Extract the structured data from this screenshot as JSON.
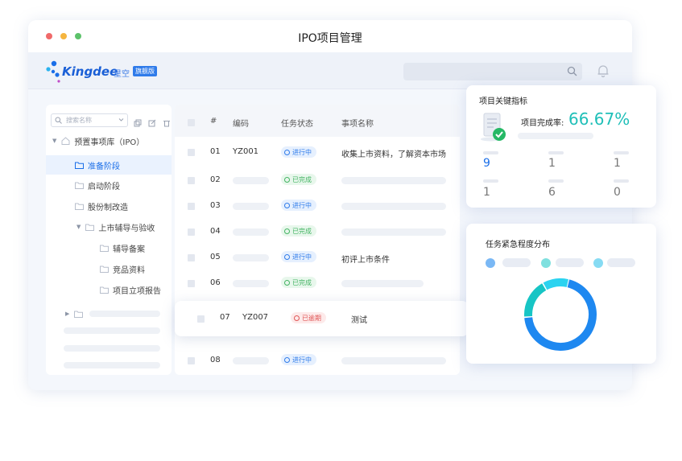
{
  "window": {
    "title": "IPO项目管理"
  },
  "brand": {
    "name": "Kingdee",
    "product": "星空",
    "edition": "旗舰版"
  },
  "sidebar": {
    "search_placeholder": "搜索名称",
    "tree": [
      {
        "label": "预置事项库（IPO）"
      },
      {
        "label": "准备阶段"
      },
      {
        "label": "启动阶段"
      },
      {
        "label": "股份制改造"
      },
      {
        "label": "上市辅导与验收"
      },
      {
        "label": "辅导备案"
      },
      {
        "label": "竞品资料"
      },
      {
        "label": "项目立项报告"
      }
    ]
  },
  "table": {
    "headers": {
      "index": "#",
      "code": "编码",
      "status": "任务状态",
      "name": "事项名称"
    },
    "rows": [
      {
        "index": "01",
        "code": "YZ001",
        "status": "进行中",
        "name": "收集上市资料，了解资本市场"
      },
      {
        "index": "02",
        "code": "",
        "status": "已完成",
        "name": ""
      },
      {
        "index": "03",
        "code": "",
        "status": "进行中",
        "name": ""
      },
      {
        "index": "04",
        "code": "",
        "status": "已完成",
        "name": ""
      },
      {
        "index": "05",
        "code": "",
        "status": "进行中",
        "name": "初评上市条件"
      },
      {
        "index": "06",
        "code": "",
        "status": "已完成",
        "name": ""
      },
      {
        "index": "07",
        "code": "YZ007",
        "status": "已逾期",
        "name": "测试"
      },
      {
        "index": "08",
        "code": "",
        "status": "进行中",
        "name": ""
      }
    ]
  },
  "kpi": {
    "title": "项目关键指标",
    "rate_label": "项目完成率:",
    "rate_value": "66.67%",
    "stats": [
      "9",
      "1",
      "1",
      "1",
      "6",
      "0"
    ]
  },
  "urgency": {
    "title": "任务紧急程度分布",
    "chart_data": {
      "type": "donut",
      "series": [
        {
          "color": "#1e88f0",
          "value": 70
        },
        {
          "color": "#17c5c5",
          "value": 18
        },
        {
          "color": "#2bd3f0",
          "value": 12
        }
      ]
    }
  },
  "colors": {
    "primary": "#1a6ee8",
    "teal": "#1fbfb8",
    "in_progress": "#2f7bea",
    "done": "#44b463",
    "overdue": "#e05656"
  }
}
